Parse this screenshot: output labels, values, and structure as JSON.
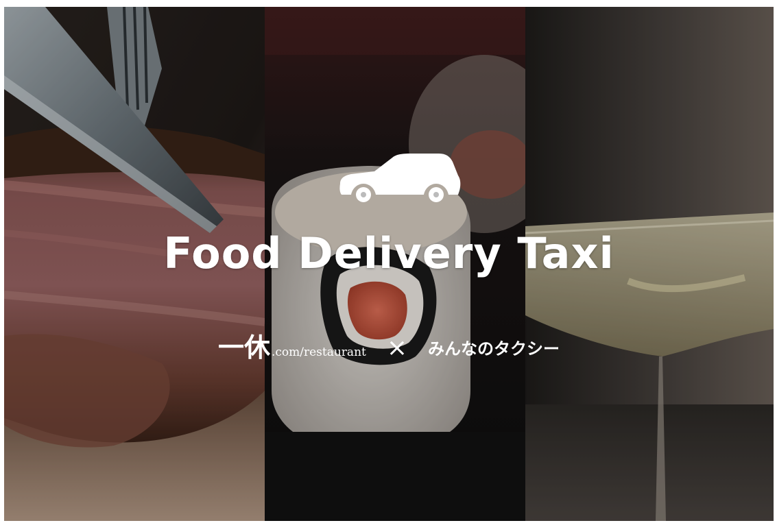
{
  "hero": {
    "title": "Food Delivery Taxi",
    "partners": {
      "ikkyu_kanji": "一休",
      "ikkyu_domain": ".com/restaurant",
      "separator": "×",
      "minna": "みんなのタクシー"
    }
  },
  "icons": {
    "car": "car-icon"
  },
  "colors": {
    "text": "#ffffff",
    "overlay": "#000000"
  }
}
